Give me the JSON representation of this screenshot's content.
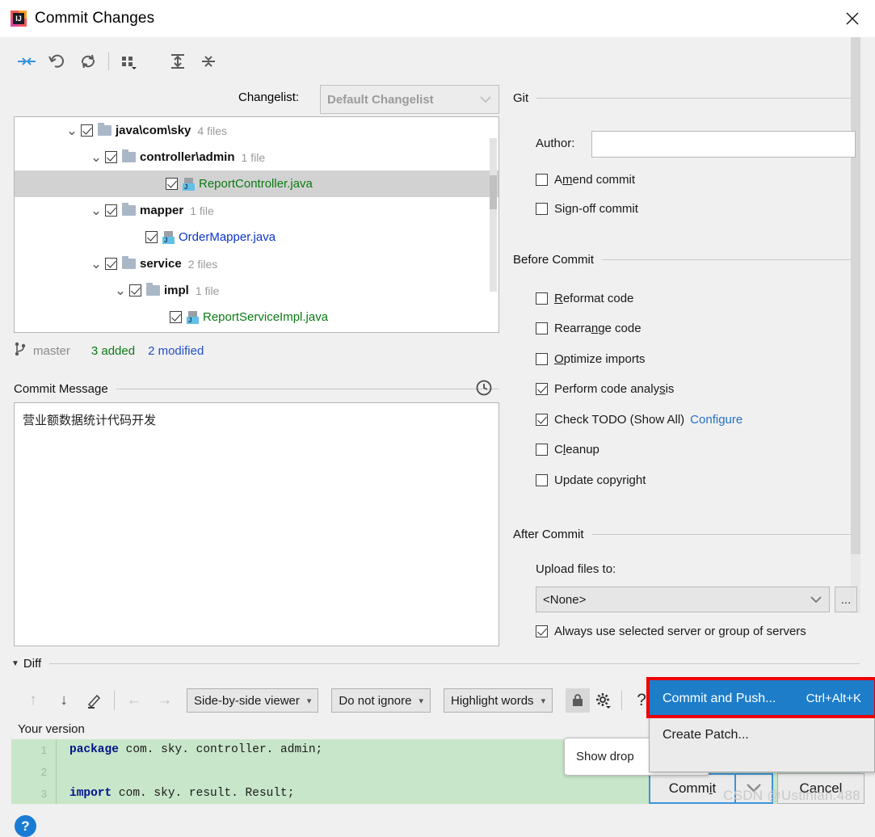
{
  "window": {
    "title": "Commit Changes",
    "app_icon": "intellij-idea-icon",
    "close_icon": "close-icon"
  },
  "toolbar": {
    "buttons": [
      {
        "name": "move-to-another-changelist-icon",
        "glyph": "arrows-to-center"
      },
      {
        "name": "rollback-icon",
        "glyph": "undo"
      },
      {
        "name": "refresh-icon",
        "glyph": "refresh"
      },
      {
        "name": "group-by-icon",
        "glyph": "grid-dropdown"
      },
      {
        "name": "expand-all-icon",
        "glyph": "expand"
      },
      {
        "name": "collapse-all-icon",
        "glyph": "collapse"
      }
    ],
    "changelist_label": "Changelist:",
    "changelist_value": "Default Changelist"
  },
  "tree": {
    "rows": [
      {
        "indent": 60,
        "chevron": "⌄",
        "checked": true,
        "kind": "folder",
        "name": "java\\com\\sky",
        "count": "4 files",
        "selected": false
      },
      {
        "indent": 90,
        "chevron": "⌄",
        "checked": true,
        "kind": "folder",
        "name": "controller\\admin",
        "count": "1 file",
        "selected": false
      },
      {
        "indent": 165,
        "chevron": "",
        "checked": true,
        "kind": "java-added",
        "name": "ReportController.java",
        "count": "",
        "selected": true
      },
      {
        "indent": 90,
        "chevron": "⌄",
        "checked": true,
        "kind": "folder",
        "name": "mapper",
        "count": "1 file",
        "selected": false
      },
      {
        "indent": 140,
        "chevron": "",
        "checked": true,
        "kind": "java-modified",
        "name": "OrderMapper.java",
        "count": "",
        "selected": false
      },
      {
        "indent": 90,
        "chevron": "⌄",
        "checked": true,
        "kind": "folder",
        "name": "service",
        "count": "2 files",
        "selected": false
      },
      {
        "indent": 120,
        "chevron": "⌄",
        "checked": true,
        "kind": "folder",
        "name": "impl",
        "count": "1 file",
        "selected": false
      },
      {
        "indent": 170,
        "chevron": "",
        "checked": true,
        "kind": "java-added",
        "name": "ReportServiceImpl.java",
        "count": "",
        "selected": false
      }
    ]
  },
  "branch_bar": {
    "branch_icon": "git-branch-icon",
    "branch": "master",
    "added": "3 added",
    "modified": "2 modified"
  },
  "commit_message": {
    "section_label": "Commit Message",
    "history_icon": "clock-history-icon",
    "value": "营业额数据统计代码开发"
  },
  "options": {
    "git": {
      "section_label": "Git",
      "author_label": "Author:",
      "author_value": "",
      "checkboxes": [
        {
          "label_pre": "A",
          "label_mn": "m",
          "label_post": "end commit",
          "checked": false,
          "name": "amend-commit"
        },
        {
          "label_pre": "Si",
          "label_mn": "g",
          "label_post": "n-off commit",
          "checked": false,
          "name": "sign-off-commit"
        }
      ]
    },
    "before_commit": {
      "section_label": "Before Commit",
      "checkboxes": [
        {
          "label_pre": "",
          "label_mn": "R",
          "label_post": "eformat code",
          "checked": false,
          "name": "reformat-code"
        },
        {
          "label_pre": "Rearra",
          "label_mn": "n",
          "label_post": "ge code",
          "checked": false,
          "name": "rearrange-code"
        },
        {
          "label_pre": "",
          "label_mn": "O",
          "label_post": "ptimize imports",
          "checked": false,
          "name": "optimize-imports"
        },
        {
          "label_pre": "Perform code analy",
          "label_mn": "s",
          "label_post": "is",
          "checked": true,
          "name": "perform-code-analysis"
        },
        {
          "label_pre": "Check TODO (Show All)",
          "label_mn": "",
          "label_post": "",
          "checked": true,
          "name": "check-todo",
          "link": "Configure"
        },
        {
          "label_pre": "C",
          "label_mn": "l",
          "label_post": "eanup",
          "checked": false,
          "name": "cleanup"
        },
        {
          "label_pre": "Update copyright",
          "label_mn": "",
          "label_post": "",
          "checked": false,
          "name": "update-copyright"
        }
      ]
    },
    "after_commit": {
      "section_label": "After Commit",
      "upload_label": "Upload files to:",
      "upload_value": "<None>",
      "browse_label": "...",
      "always_use_label": "Always use selected server or group of servers",
      "always_use_checked": true
    }
  },
  "diff": {
    "section_label": "Diff",
    "icons": [
      {
        "name": "previous-difference-icon",
        "glyph": "↑",
        "dim": true
      },
      {
        "name": "next-difference-icon",
        "glyph": "↓",
        "dim": false
      },
      {
        "name": "edit-source-icon",
        "glyph": "✎",
        "dim": false
      },
      {
        "name": "accept-left-icon",
        "glyph": "←",
        "dim": true
      },
      {
        "name": "accept-right-icon",
        "glyph": "→",
        "dim": true
      }
    ],
    "viewer_mode": "Side-by-side viewer",
    "ignore_policy": "Do not ignore",
    "highlight_policy": "Highlight words",
    "lock_icon": "lock-icon",
    "settings_icon": "gear-icon",
    "help_icon": "question-icon",
    "your_version_label": "Your version",
    "code_lines": [
      {
        "num": "1",
        "kw": "package",
        "rest": " com. sky. controller. admin;"
      },
      {
        "num": "2",
        "kw": "",
        "rest": ""
      },
      {
        "num": "3",
        "kw": "import",
        "rest": " com. sky. result. Result;"
      }
    ]
  },
  "footer": {
    "help_label": "?",
    "commit_pre": "Comm",
    "commit_mn": "i",
    "commit_post": "t",
    "commit_dropdown_icon": "chevron-down-icon",
    "cancel_label": "Cancel"
  },
  "popup": {
    "items": [
      {
        "label": "Commit and Push...",
        "shortcut": "Ctrl+Alt+K",
        "highlighted": true,
        "name": "commit-and-push"
      },
      {
        "label": "Create Patch...",
        "shortcut": "",
        "highlighted": false,
        "name": "create-patch"
      }
    ]
  },
  "tooltip": {
    "text": "Show drop"
  },
  "watermark": {
    "text": "CSDN @Ustinian.488"
  }
}
